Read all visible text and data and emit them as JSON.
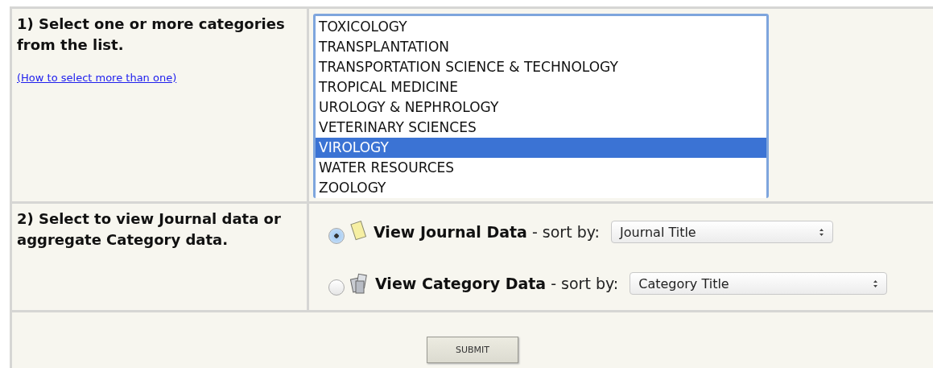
{
  "step1": {
    "title": "1) Select one or more categories from the list.",
    "help_link": "(How to select more than one)"
  },
  "categories": [
    {
      "label": "TOXICOLOGY",
      "selected": false
    },
    {
      "label": "TRANSPLANTATION",
      "selected": false
    },
    {
      "label": "TRANSPORTATION SCIENCE & TECHNOLOGY",
      "selected": false
    },
    {
      "label": "TROPICAL MEDICINE",
      "selected": false
    },
    {
      "label": "UROLOGY & NEPHROLOGY",
      "selected": false
    },
    {
      "label": "VETERINARY SCIENCES",
      "selected": false
    },
    {
      "label": "VIROLOGY",
      "selected": true
    },
    {
      "label": "WATER RESOURCES",
      "selected": false
    },
    {
      "label": "ZOOLOGY",
      "selected": false
    }
  ],
  "step2": {
    "title": "2) Select to view Journal data or aggregate Category data."
  },
  "view_options": [
    {
      "kind": "journal",
      "label": "View Journal Data",
      "sort_label": "- sort by:",
      "sort_value": "Journal Title",
      "selected": true
    },
    {
      "kind": "category",
      "label": "View Category Data",
      "sort_label": "- sort by:",
      "sort_value": "Category Title",
      "selected": false
    }
  ],
  "submit": "SUBMIT"
}
